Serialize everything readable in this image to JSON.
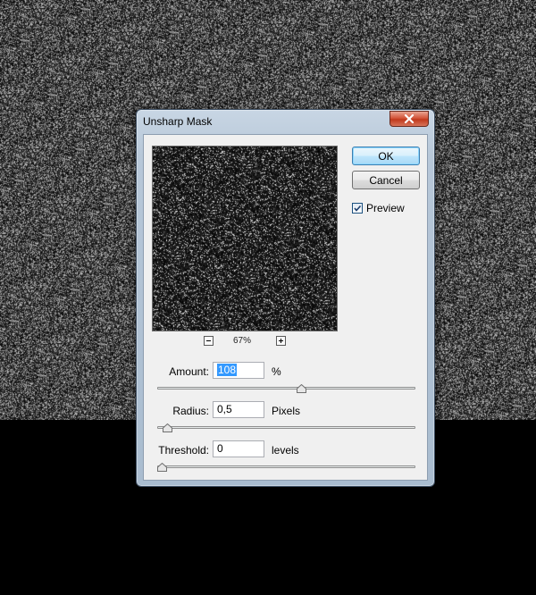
{
  "dialog": {
    "title": "Unsharp Mask",
    "close_icon": "close-icon",
    "buttons": {
      "ok": "OK",
      "cancel": "Cancel"
    },
    "preview_checkbox": {
      "label": "Preview",
      "checked": true
    },
    "zoom": {
      "value": "67%",
      "minus_icon": "zoom-out-icon",
      "plus_icon": "zoom-in-icon"
    },
    "params": {
      "amount": {
        "label": "Amount:",
        "value": "108",
        "unit": "%",
        "slider_fraction": 0.56
      },
      "radius": {
        "label": "Radius:",
        "value": "0,5",
        "unit": "Pixels",
        "slider_fraction": 0.02
      },
      "threshold": {
        "label": "Threshold:",
        "value": "0",
        "unit": "levels",
        "slider_fraction": 0.0
      }
    }
  },
  "colors": {
    "selection": "#3399ff",
    "close_button": "#c0391c",
    "background_noise": "#5a5a5a"
  }
}
